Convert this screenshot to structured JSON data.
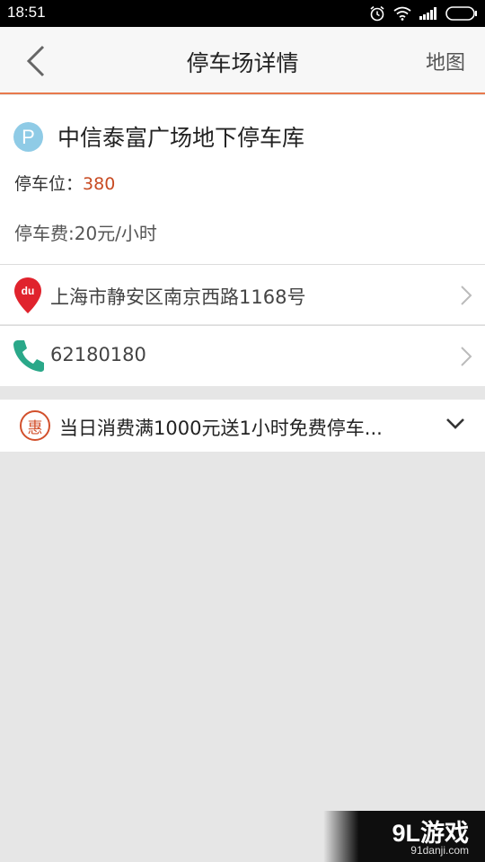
{
  "status_bar": {
    "time": "18:51",
    "icons": [
      "alarm-icon",
      "wifi-icon",
      "signal-icon",
      "battery-icon"
    ]
  },
  "header": {
    "title": "停车场详情",
    "map_label": "地图",
    "accent_color": "#e8794d"
  },
  "lot": {
    "badge": "P",
    "name": "中信泰富广场地下停车库",
    "spots_label": "停车位：",
    "spots_value": "380",
    "fee": "停车费:20元/小时",
    "spots_color": "#c84b22"
  },
  "address": {
    "icon": "baidu-map-pin-icon",
    "pin_text": "du",
    "text": "上海市静安区南京西路1168号"
  },
  "phone": {
    "icon": "phone-icon",
    "text": "62180180"
  },
  "promo": {
    "icon_text": "惠",
    "text": "当日消费满1000元送1小时免费停车..."
  },
  "watermark": {
    "brand": "9L游戏",
    "site": "91danji.com"
  }
}
